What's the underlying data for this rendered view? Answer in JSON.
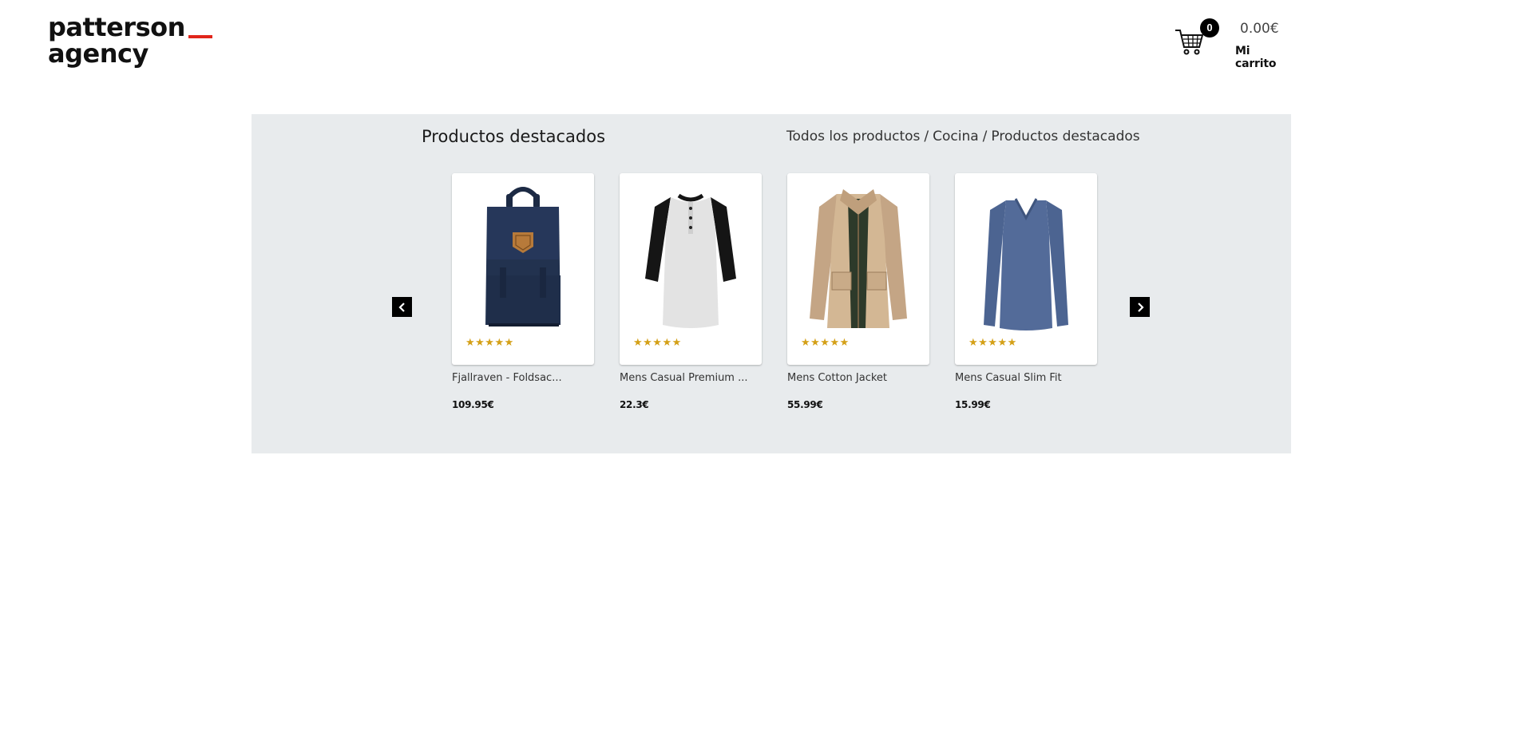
{
  "brand": {
    "line1": "patterson",
    "line2": "agency",
    "accent_color": "#e1251b"
  },
  "cart": {
    "icon": "shopping-cart-icon",
    "count": "0",
    "total": "0.00€",
    "label": "Mi carrito"
  },
  "featured": {
    "title": "Productos destacados",
    "background": "#e8ebed",
    "breadcrumb": [
      "Todos los productos",
      "Cocina",
      "Productos destacados"
    ],
    "breadcrumb_separator": "/",
    "prev_icon": "chevron-left-icon",
    "next_icon": "chevron-right-icon",
    "products": [
      {
        "name": "Fjallraven - Foldsac...",
        "price": "109.95€",
        "stars": "★★★★★",
        "rating": 5,
        "image": "backpack-image"
      },
      {
        "name": "Mens Casual Premium ...",
        "price": "22.3€",
        "stars": "★★★★★",
        "rating": 5,
        "image": "raglan-shirt-image"
      },
      {
        "name": "Mens Cotton Jacket",
        "price": "55.99€",
        "stars": "★★★★★",
        "rating": 5,
        "image": "jacket-image"
      },
      {
        "name": "Mens Casual Slim Fit",
        "price": "15.99€",
        "stars": "★★★★★",
        "rating": 5,
        "image": "long-sleeve-shirt-image"
      }
    ]
  }
}
